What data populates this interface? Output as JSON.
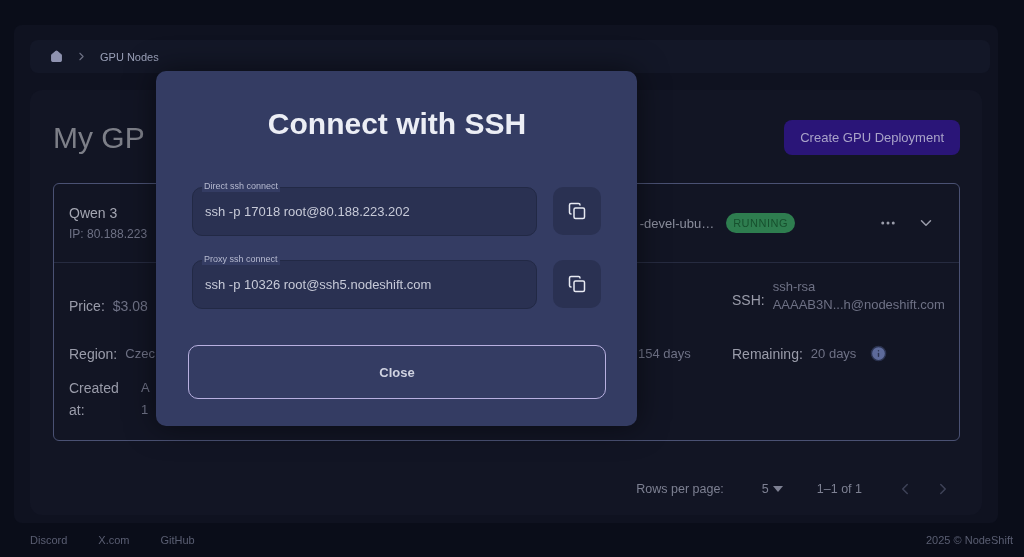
{
  "breadcrumb": {
    "current": "GPU Nodes"
  },
  "page_title": "My GP",
  "create_button": "Create GPU Deployment",
  "node": {
    "name": "Qwen 3",
    "ip": "IP: 80.188.223",
    "image": "-devel-ubu…",
    "status": {
      "label": "RUNNING",
      "kind": "running"
    },
    "price": {
      "label": "Price:",
      "value": "$3.08"
    },
    "region": {
      "label": "Region:",
      "value": "Czec"
    },
    "created": {
      "label": "Created at:",
      "value_lines": [
        "A",
        "1"
      ]
    },
    "uptime": "154 days",
    "ssh": {
      "label": "SSH:",
      "value_lines": [
        "ssh-rsa",
        "AAAAB3N...h@nodeshift.com"
      ]
    },
    "remaining": {
      "label": "Remaining:",
      "value": "20 days"
    }
  },
  "pagination": {
    "rows_label": "Rows per page:",
    "rows_value": "5",
    "range": "1–1 of 1",
    "prev_disabled": true,
    "next_disabled": true
  },
  "dialog": {
    "title": "Connect with SSH",
    "fields": [
      {
        "label": "Direct ssh connect",
        "value": "ssh -p 17018 root@80.188.223.202"
      },
      {
        "label": "Proxy ssh connect",
        "value": "ssh -p 10326 root@ssh5.nodeshift.com"
      }
    ],
    "close_button": "Close"
  },
  "footer": {
    "links": [
      "Discord",
      "X.com",
      "GitHub"
    ],
    "copyright": "2025 © NodeShift"
  }
}
